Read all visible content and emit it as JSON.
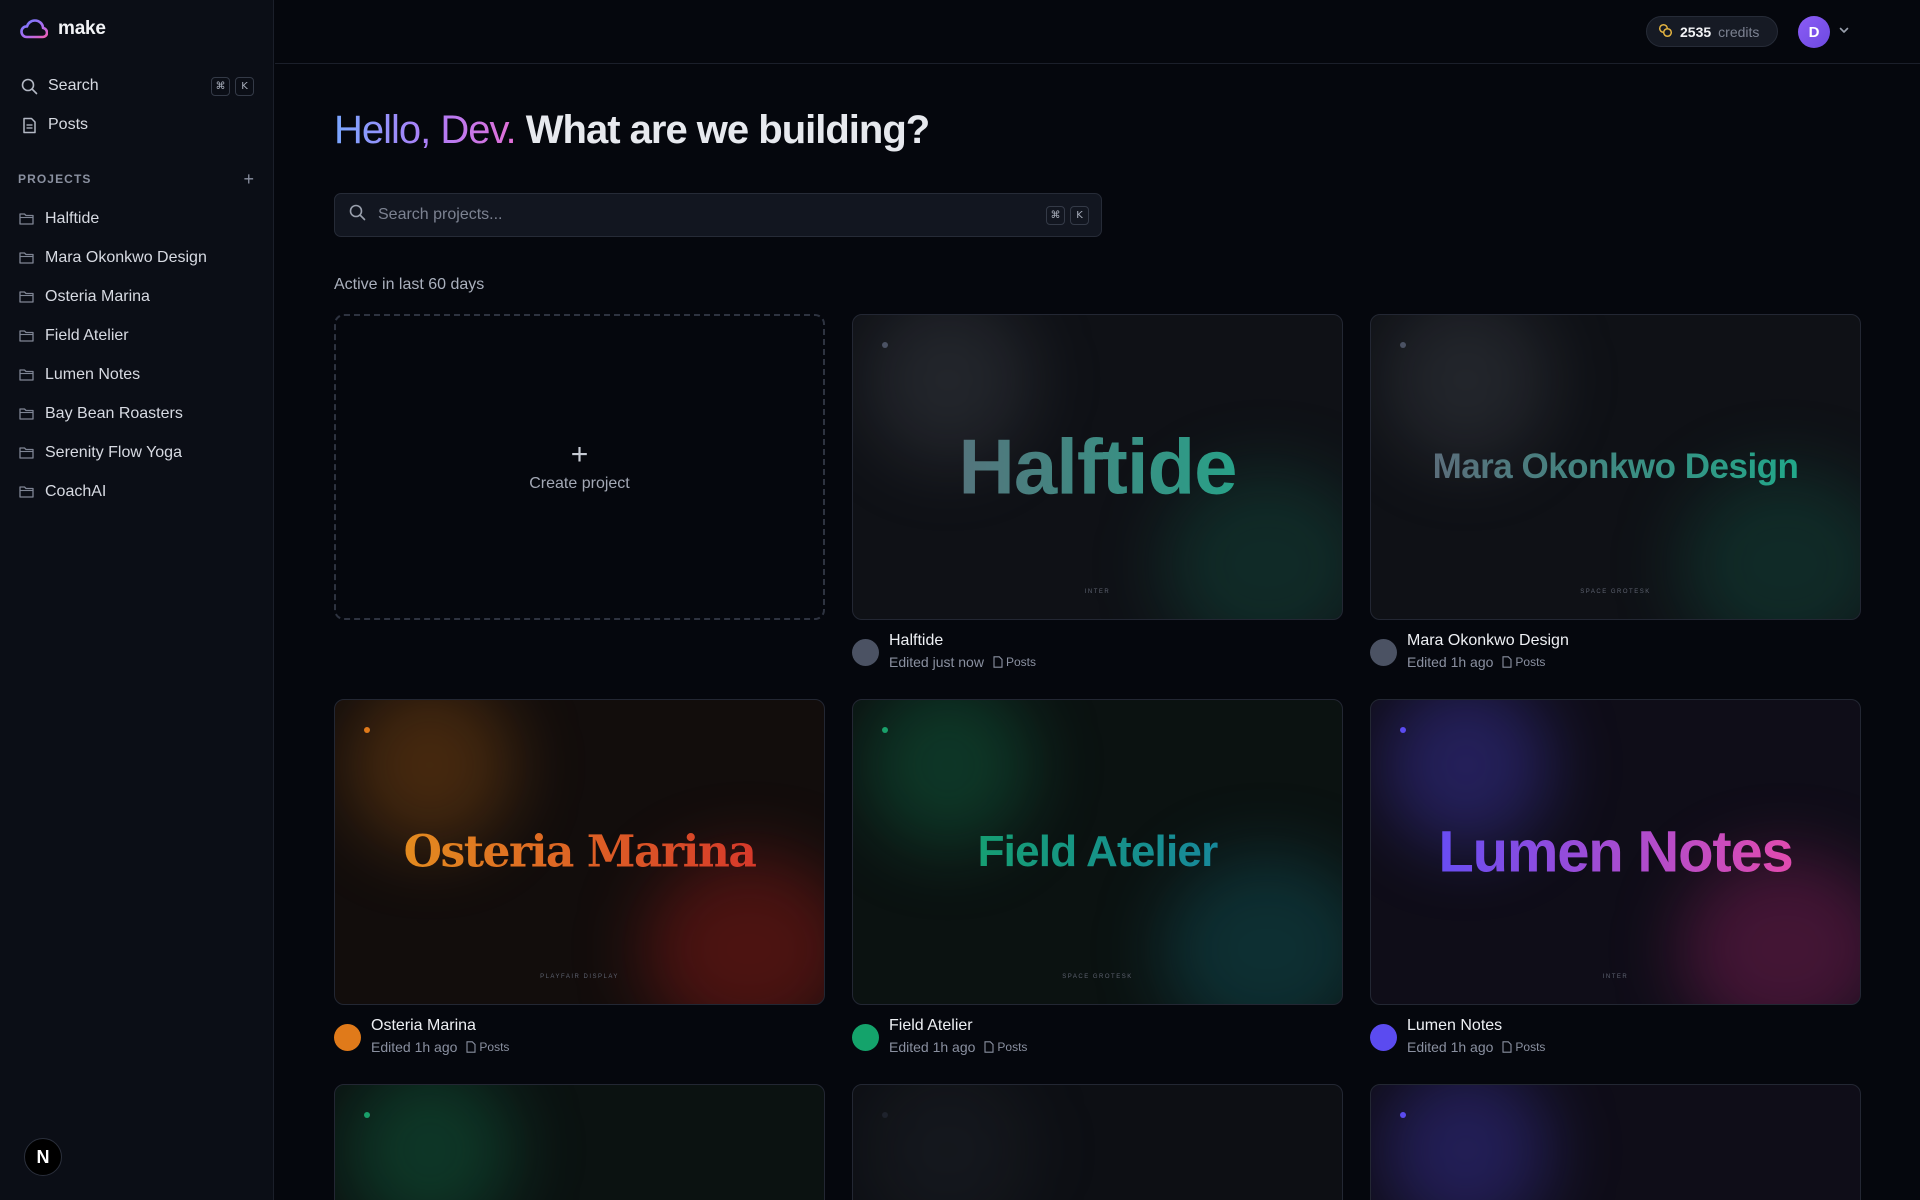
{
  "brand": {
    "name": "make"
  },
  "sidebar": {
    "search_label": "Search",
    "search_shortcut": [
      "⌘",
      "K"
    ],
    "posts_label": "Posts",
    "projects_heading": "PROJECTS",
    "projects": [
      "Halftide",
      "Mara Okonkwo Design",
      "Osteria Marina",
      "Field Atelier",
      "Lumen Notes",
      "Bay Bean Roasters",
      "Serenity Flow Yoga",
      "CoachAI"
    ],
    "bottom_badge": "N"
  },
  "topbar": {
    "credits_value": "2535",
    "credits_label": "credits",
    "avatar_initial": "D"
  },
  "main": {
    "greeting_hello": "Hello, Dev.",
    "greeting_rest": " What are we building?",
    "search_placeholder": "Search projects...",
    "search_shortcut": [
      "⌘",
      "K"
    ],
    "section_label": "Active in last 60 days",
    "create_label": "Create project",
    "cards": [
      {
        "name": "Halftide",
        "edited": "Edited just now",
        "tag": "Posts",
        "font": "INTER",
        "accent": "#5b6273",
        "avatar_color": "#4b5263"
      },
      {
        "name": "Mara Okonkwo Design",
        "edited": "Edited 1h ago",
        "tag": "Posts",
        "font": "SPACE GROTESK",
        "accent": "#5b6273",
        "avatar_color": "#4b5263"
      },
      {
        "name": "Osteria Marina",
        "edited": "Edited 1h ago",
        "tag": "Posts",
        "font": "PLAYFAIR DISPLAY",
        "accent": "#e07a1a",
        "avatar_color": "#e07a1a"
      },
      {
        "name": "Field Atelier",
        "edited": "Edited 1h ago",
        "tag": "Posts",
        "font": "SPACE GROTESK",
        "accent": "#19a06a",
        "avatar_color": "#14a36b"
      },
      {
        "name": "Lumen Notes",
        "edited": "Edited 1h ago",
        "tag": "Posts",
        "font": "INTER",
        "accent": "#5b4bf0",
        "avatar_color": "#5b4bf0"
      }
    ]
  }
}
